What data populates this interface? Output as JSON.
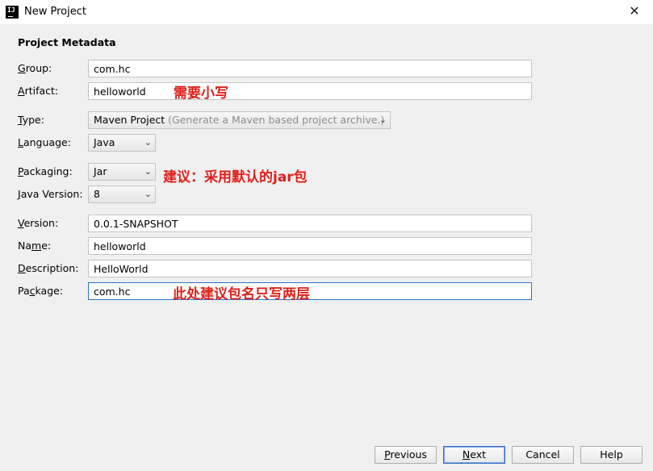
{
  "window": {
    "title": "New Project",
    "close_glyph": "✕",
    "app_icon": "IJ"
  },
  "section_title": "Project Metadata",
  "form": {
    "group": {
      "label_mn": "G",
      "label_rest": "roup:",
      "value": "com.hc"
    },
    "artifact": {
      "label_mn": "A",
      "label_rest": "rtifact:",
      "value": "helloworld"
    },
    "type": {
      "label_mn": "T",
      "label_rest": "ype:",
      "value": "Maven Project",
      "hint": " (Generate a Maven based project archive.)"
    },
    "language": {
      "label_mn": "L",
      "label_rest": "anguage:",
      "value": "Java"
    },
    "packaging": {
      "label_mn": "P",
      "label_rest": "ackaging:",
      "value": "Jar"
    },
    "java_version": {
      "label_mn": "J",
      "label_rest": "ava Version:",
      "value": "8"
    },
    "version": {
      "label_mn": "V",
      "label_rest": "ersion:",
      "value": "0.0.1-SNAPSHOT"
    },
    "name": {
      "label_pre": "Na",
      "label_mn": "m",
      "label_rest": "e:",
      "value": "helloworld"
    },
    "description": {
      "label_mn": "D",
      "label_rest": "escription:",
      "value": "HelloWorld"
    },
    "package": {
      "label_pre": "Pa",
      "label_mn": "c",
      "label_rest": "kage:",
      "value": "com.hc"
    }
  },
  "annotations": {
    "artifact_note": "需要小写",
    "packaging_note": "建议：采用默认的jar包",
    "package_note": "此处建议包名只写两层"
  },
  "buttons": {
    "previous": {
      "mn": "P",
      "rest": "revious"
    },
    "next": {
      "mn": "N",
      "rest": "ext"
    },
    "cancel": "Cancel",
    "help": "Help"
  },
  "icons": {
    "dropdown": "chevron-down-icon",
    "close": "close-icon",
    "app": "intellij-icon"
  }
}
